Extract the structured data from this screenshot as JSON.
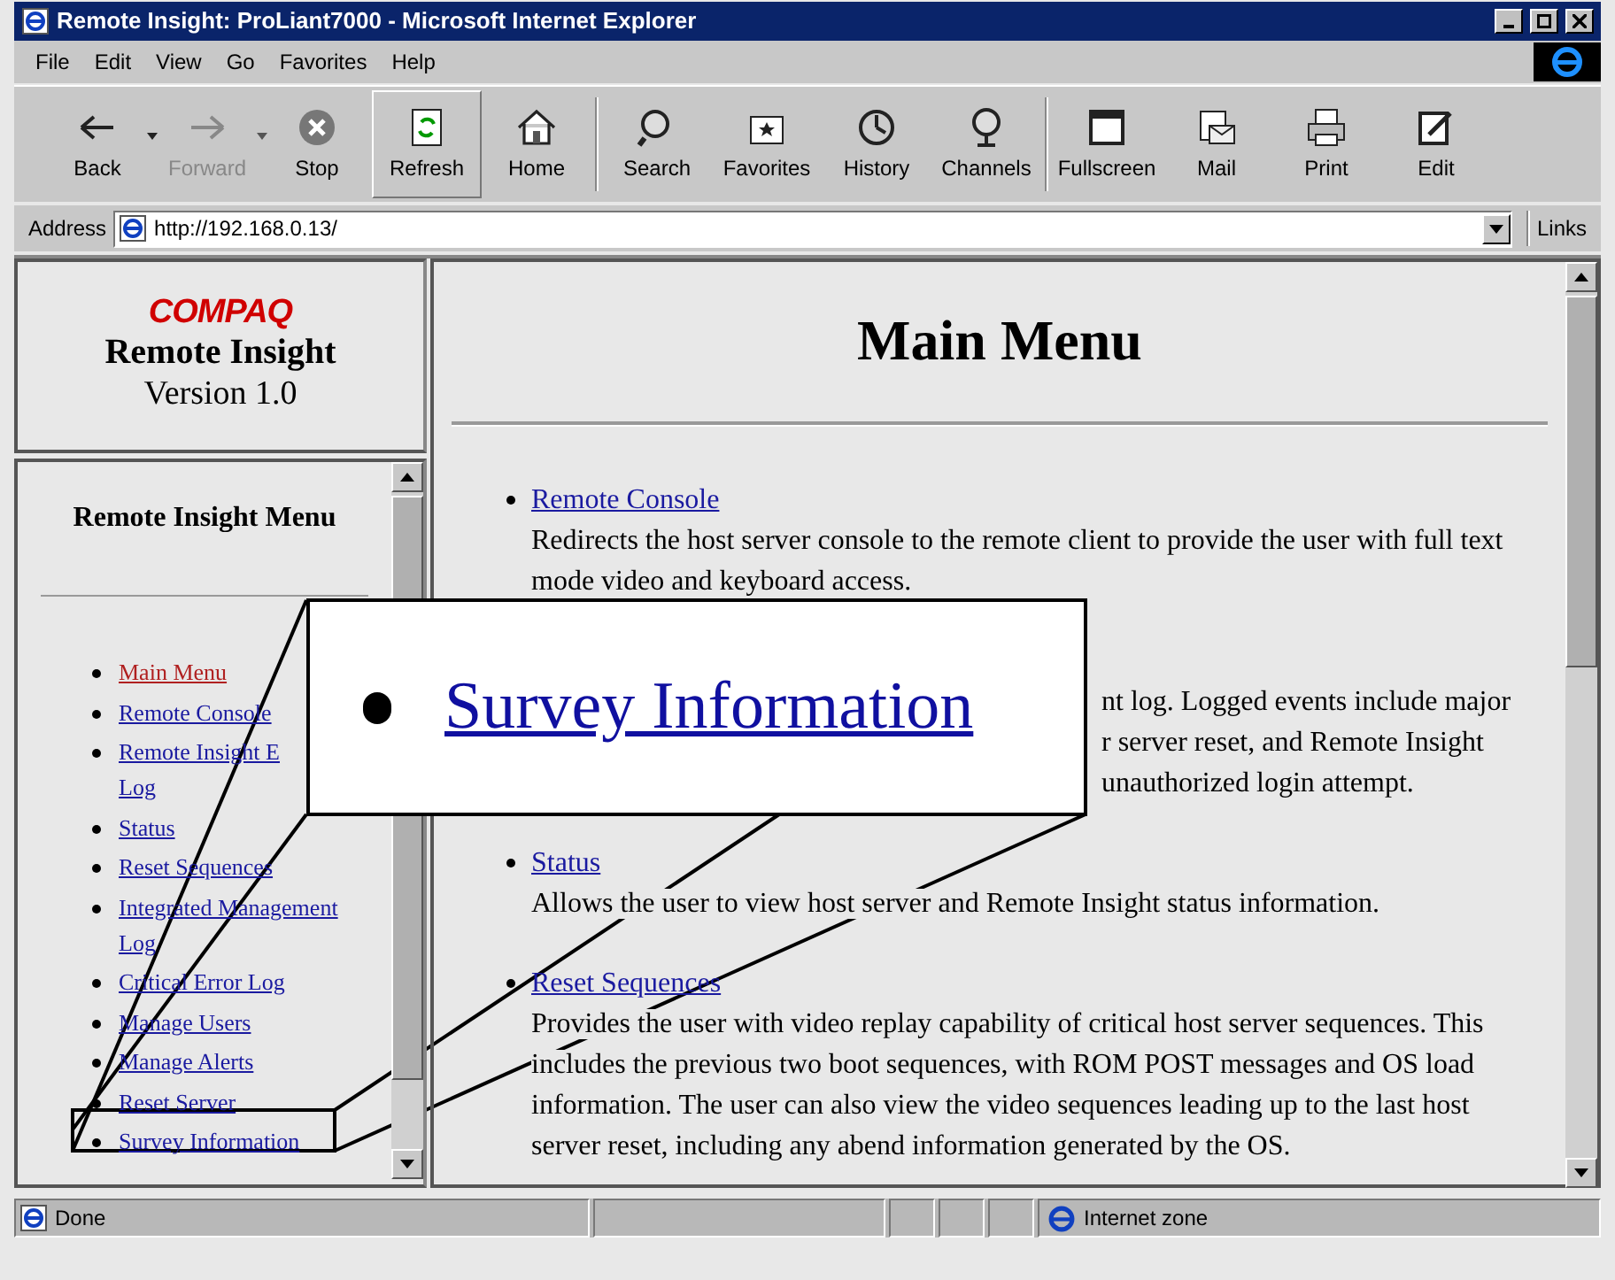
{
  "window": {
    "title": "Remote Insight:  ProLiant7000 - Microsoft Internet Explorer"
  },
  "menu_bar": [
    "File",
    "Edit",
    "View",
    "Go",
    "Favorites",
    "Help"
  ],
  "toolbar": [
    {
      "kind": "back",
      "label": "Back",
      "disabled": false,
      "dropdown": true,
      "raised": false
    },
    {
      "kind": "forward",
      "label": "Forward",
      "disabled": true,
      "dropdown": true,
      "raised": false
    },
    {
      "kind": "stop",
      "label": "Stop",
      "disabled": false,
      "dropdown": false,
      "raised": false
    },
    {
      "kind": "refresh",
      "label": "Refresh",
      "disabled": false,
      "dropdown": false,
      "raised": true
    },
    {
      "kind": "home",
      "label": "Home",
      "disabled": false,
      "dropdown": false,
      "raised": false
    },
    {
      "kind": "search",
      "label": "Search",
      "disabled": false,
      "dropdown": false,
      "raised": false
    },
    {
      "kind": "favorites",
      "label": "Favorites",
      "disabled": false,
      "dropdown": false,
      "raised": false
    },
    {
      "kind": "history",
      "label": "History",
      "disabled": false,
      "dropdown": false,
      "raised": false
    },
    {
      "kind": "channels",
      "label": "Channels",
      "disabled": false,
      "dropdown": false,
      "raised": false
    },
    {
      "kind": "fullscreen",
      "label": "Fullscreen",
      "disabled": false,
      "dropdown": false,
      "raised": false
    },
    {
      "kind": "mail",
      "label": "Mail",
      "disabled": false,
      "dropdown": false,
      "raised": false
    },
    {
      "kind": "print",
      "label": "Print",
      "disabled": false,
      "dropdown": false,
      "raised": false
    },
    {
      "kind": "edit",
      "label": "Edit",
      "disabled": false,
      "dropdown": false,
      "raised": false
    }
  ],
  "address_bar": {
    "label": "Address",
    "url": "http://192.168.0.13/",
    "links": "Links"
  },
  "logo_frame": {
    "brand": "COMPAQ",
    "product": "Remote Insight",
    "version": "Version 1.0"
  },
  "menu_frame": {
    "heading": "Remote Insight Menu",
    "items": [
      {
        "label": "Main Menu",
        "selected": true
      },
      {
        "label": "Remote Console",
        "selected": false
      },
      {
        "label": "Remote Insight E",
        "continuation": "Log",
        "selected": false
      },
      {
        "label": "Status",
        "selected": false
      },
      {
        "label": "Reset Sequences",
        "selected": false
      },
      {
        "label": "Integrated Management Log",
        "selected": false
      },
      {
        "label": "Critical Error Log",
        "selected": false
      },
      {
        "label": "Manage Users",
        "selected": false
      },
      {
        "label": "Manage Alerts",
        "selected": false
      },
      {
        "label": "Reset Server",
        "selected": false
      },
      {
        "label": "Survey Information",
        "selected": false
      }
    ]
  },
  "main_frame": {
    "heading": "Main Menu",
    "items": [
      {
        "kind": "entry",
        "link": "Remote Console",
        "description": "Redirects the host server console to the remote client to provide the user with full text mode video and keyboard access."
      },
      {
        "kind": "obscured",
        "fragments": [
          "nt log. Logged events include major",
          "r server reset, and Remote Insight",
          "unauthorized login attempt."
        ]
      },
      {
        "kind": "entry",
        "link": "Status",
        "description": "Allows the user to view host server and Remote Insight status information."
      },
      {
        "kind": "entry",
        "link": "Reset Sequences",
        "description": "Provides the user with video replay capability of critical host server sequences. This includes the previous two boot sequences, with ROM POST messages and OS load information. The user can also view the video sequences leading up to the last host server reset, including any abend information generated by the OS."
      }
    ]
  },
  "callout": {
    "text": "Survey Information"
  },
  "status_bar": {
    "text": "Done",
    "zone": "Internet zone"
  }
}
